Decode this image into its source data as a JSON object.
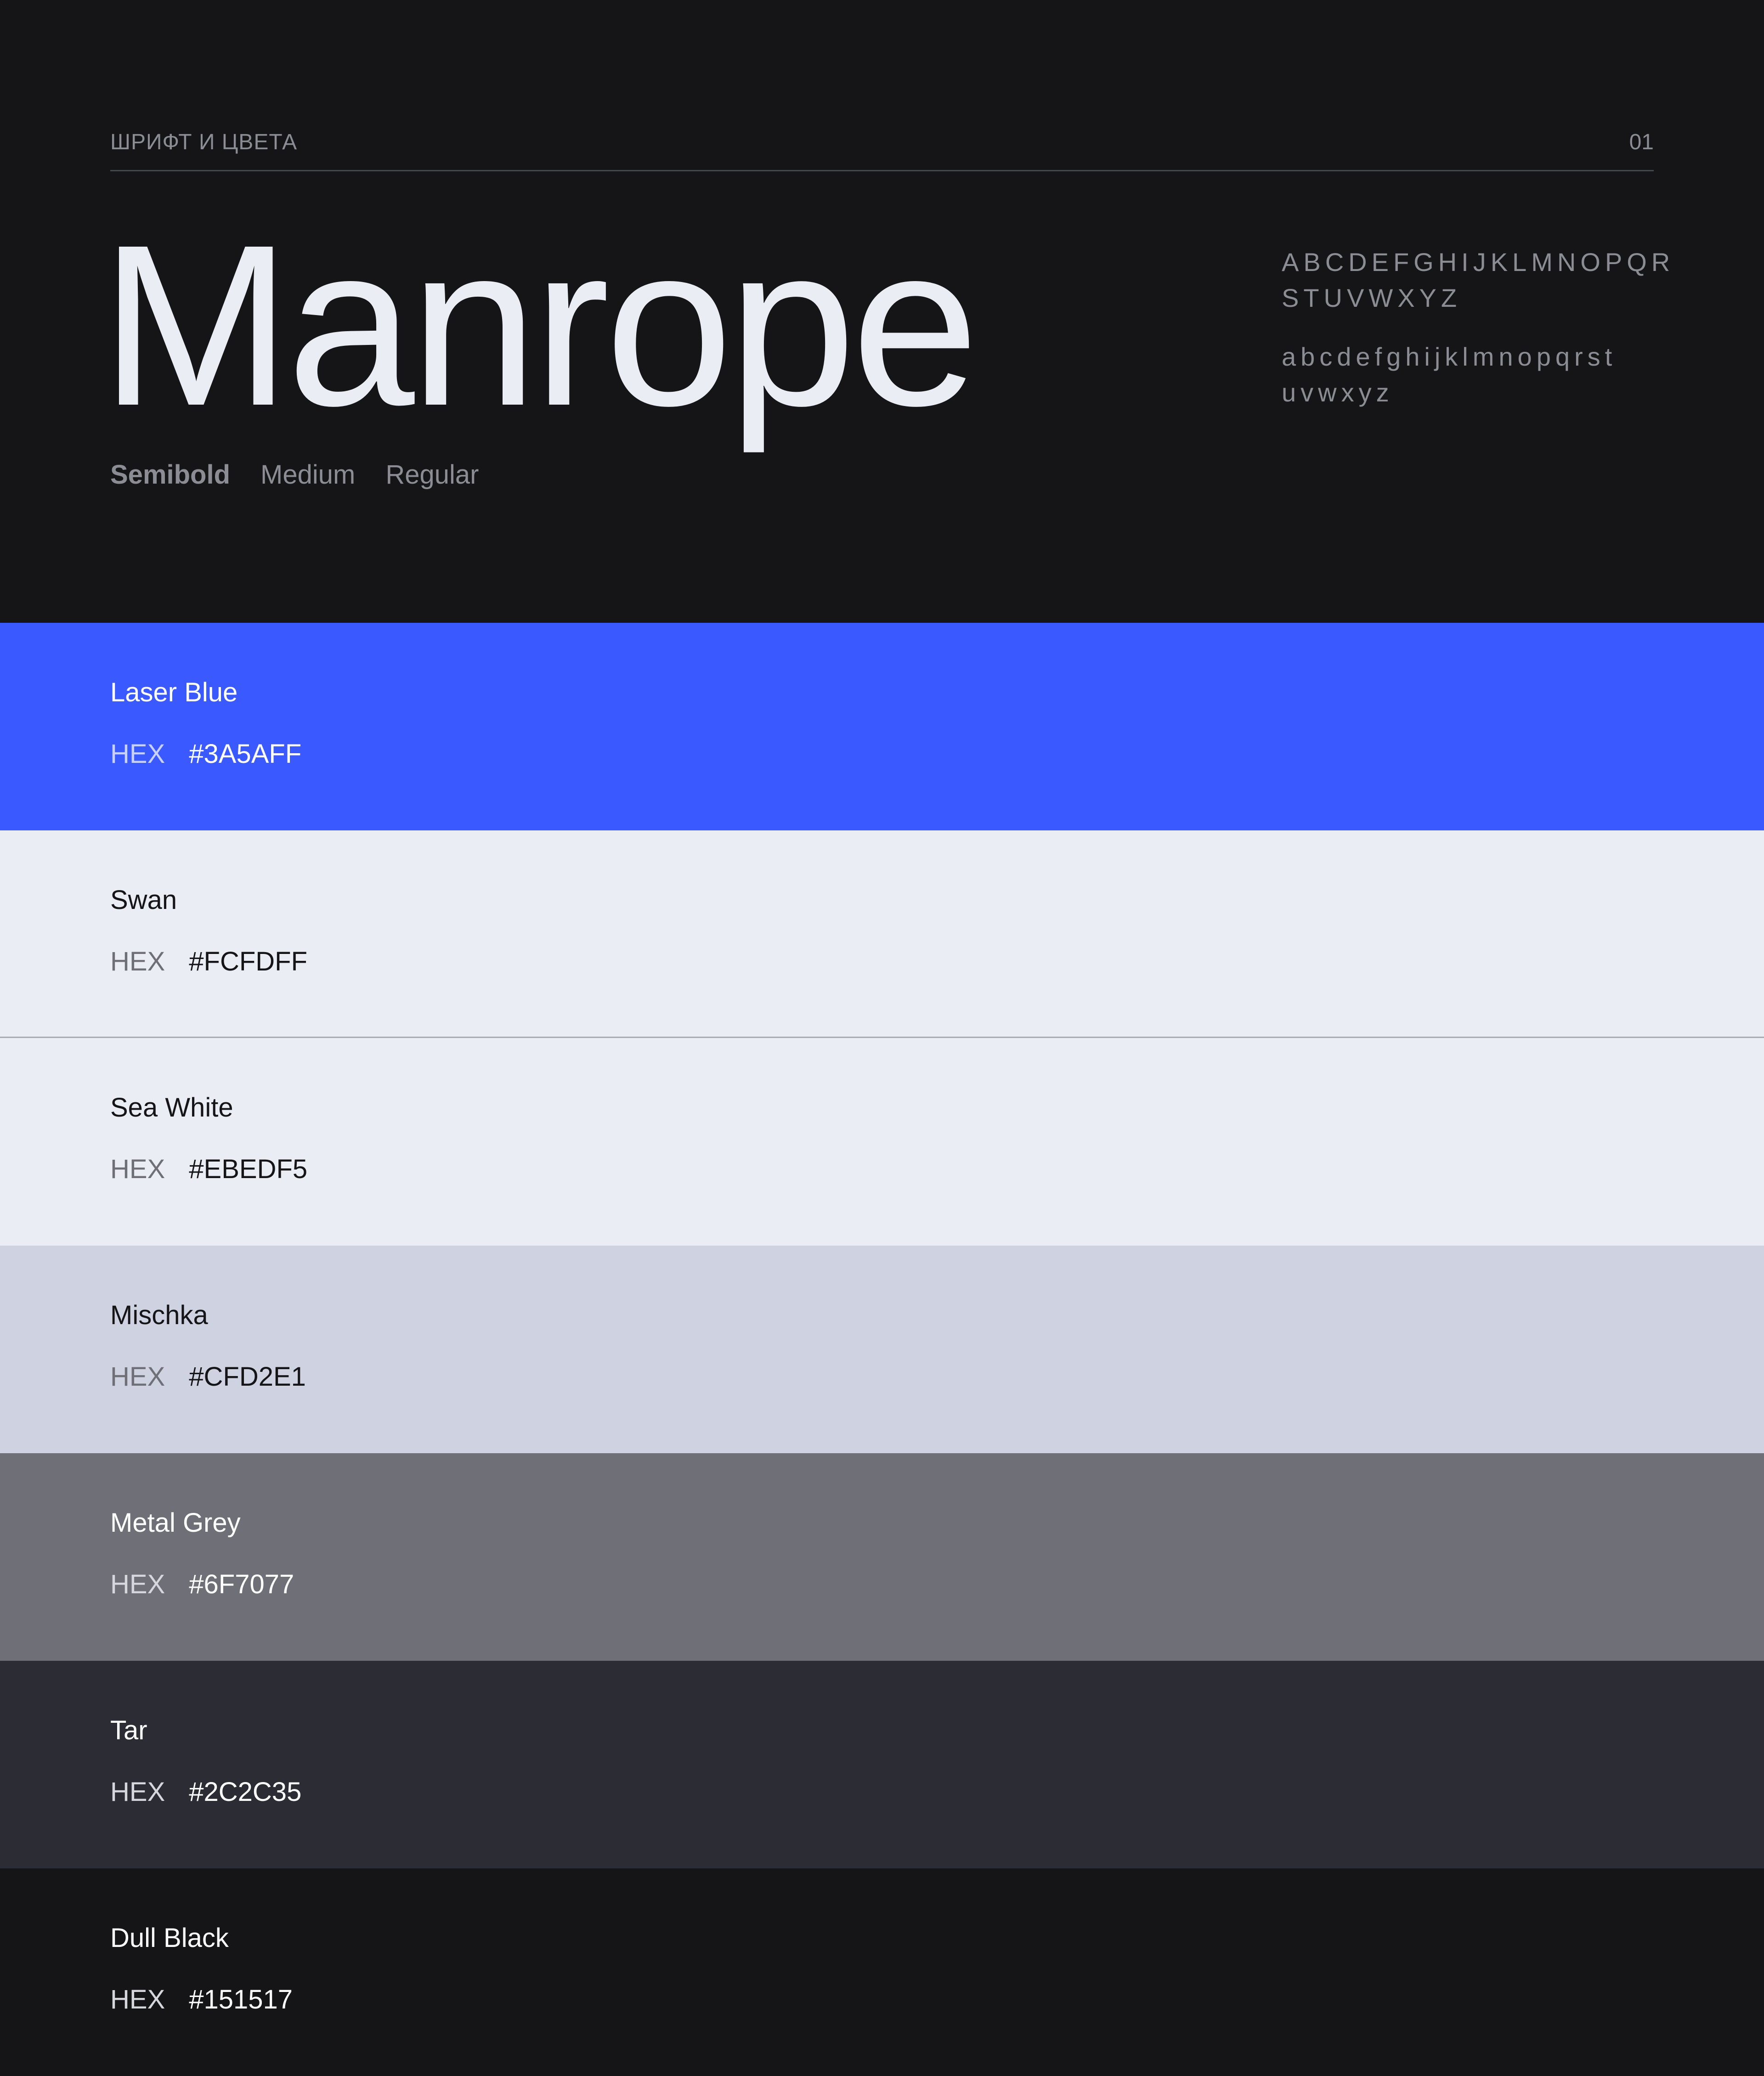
{
  "header": {
    "section_title": "ШРИФТ И ЦВЕТА",
    "section_number": "01",
    "font_name": "Manrope",
    "weights": [
      "Semibold",
      "Medium",
      "Regular"
    ],
    "uppercase_line_1": "ABCDEFGHIJKLMNOPQR",
    "uppercase_line_2": "STUVWXYZ",
    "lowercase_line_1": "abcdefghijklmnopqrst",
    "lowercase_line_2": "uvwxyz"
  },
  "colors": [
    {
      "name": "Laser Blue",
      "hex_label": "HEX",
      "hex": "#3A5AFF",
      "background": "#3A5AFF",
      "name_color": "#FFFFFF",
      "label_color": "#C8D0FF",
      "value_color": "#FFFFFF"
    },
    {
      "name": "Swan",
      "hex_label": "HEX",
      "hex": "#FCFDFF",
      "background": "#EBEDF5",
      "name_color": "#151517",
      "label_color": "#6F7077",
      "value_color": "#151517"
    },
    {
      "name": "Sea White",
      "hex_label": "HEX",
      "hex": "#EBEDF5",
      "background": "#EBEDF5",
      "name_color": "#151517",
      "label_color": "#6F7077",
      "value_color": "#151517"
    },
    {
      "name": "Mischka",
      "hex_label": "HEX",
      "hex": "#CFD2E1",
      "background": "#CFD2E1",
      "name_color": "#151517",
      "label_color": "#6F7077",
      "value_color": "#151517"
    },
    {
      "name": "Metal Grey",
      "hex_label": "HEX",
      "hex": "#6F7077",
      "background": "#6F7077",
      "name_color": "#FFFFFF",
      "label_color": "#D6D7DD",
      "value_color": "#FFFFFF"
    },
    {
      "name": "Tar",
      "hex_label": "HEX",
      "hex": "#2C2C35",
      "background": "#2C2C35",
      "name_color": "#FFFFFF",
      "label_color": "#D6D7DD",
      "value_color": "#FFFFFF"
    },
    {
      "name": "Dull Black",
      "hex_label": "HEX",
      "hex": "#151517",
      "background": "#151517",
      "name_color": "#FFFFFF",
      "label_color": "#D6D7DD",
      "value_color": "#FFFFFF"
    }
  ]
}
